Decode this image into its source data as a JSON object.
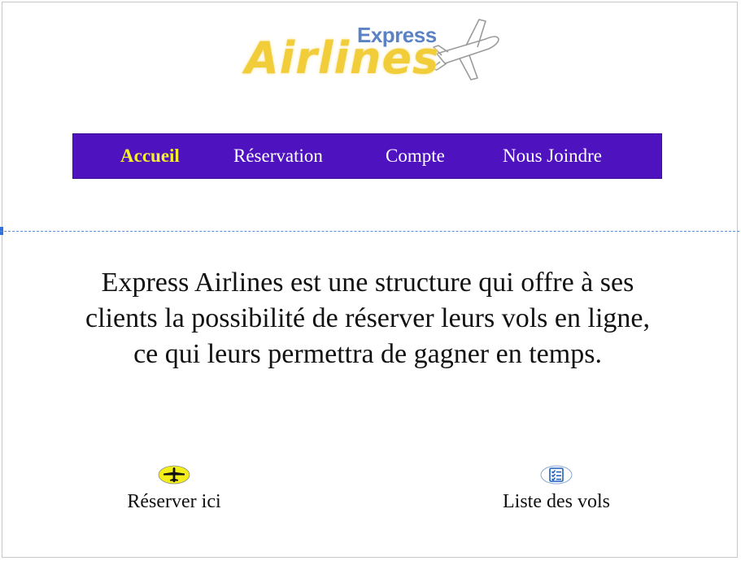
{
  "logo": {
    "express": "Express",
    "airlines": "Airlines",
    "icon": "airplane-logo-icon",
    "colors": {
      "express": "#5a82c4",
      "airlines": "#f1cd3a"
    }
  },
  "nav": {
    "background": "#4f12bf",
    "items": [
      {
        "label": "Accueil",
        "active": true
      },
      {
        "label": "Réservation",
        "active": false
      },
      {
        "label": "Compte",
        "active": false
      },
      {
        "label": "Nous Joindre",
        "active": false
      }
    ],
    "active_color": "#f4f02a"
  },
  "intro": {
    "lines": [
      "Express Airlines est une structure qui offre à ses",
      "clients la possibilité de réserver leurs vols en ligne,",
      "ce qui leurs permettra de gagner en temps."
    ]
  },
  "actions": [
    {
      "label": "Réserver ici",
      "icon": "airplane-icon"
    },
    {
      "label": "Liste des vols",
      "icon": "checklist-icon"
    }
  ]
}
